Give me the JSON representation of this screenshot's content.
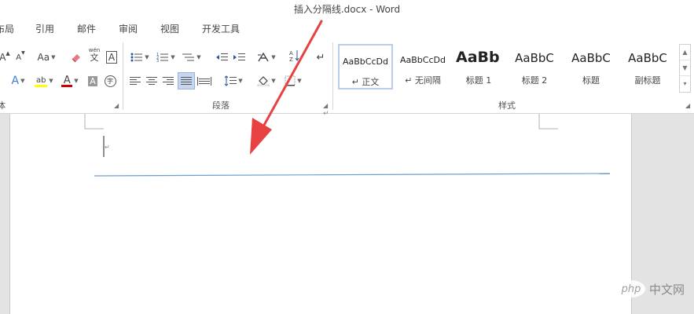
{
  "window": {
    "title": "插入分隔线.docx - Word"
  },
  "tabs": [
    "布局",
    "引用",
    "邮件",
    "审阅",
    "视图",
    "开发工具"
  ],
  "ribbon": {
    "font_size_buttons": {
      "grow": "A",
      "shrink": "A",
      "change_case": "Aa"
    },
    "phonetic_label": "wén",
    "phonetic_char": "文",
    "border_char": "A",
    "char_shading": "A",
    "enclose_char": "字",
    "font_color_letter": "A",
    "text_effect_letter": "A",
    "groups": {
      "font_label": "体",
      "paragraph_label": "段落",
      "styles_label": "样式"
    },
    "styles": [
      {
        "sample": "AaBbCcDd",
        "name": "↵ 正文",
        "selected": true
      },
      {
        "sample": "AaBbCcDd",
        "name": "↵ 无间隔",
        "selected": false
      },
      {
        "sample": "AaBb",
        "name": "标题 1",
        "selected": false
      },
      {
        "sample": "AaBbC",
        "name": "标题 2",
        "selected": false
      },
      {
        "sample": "AaBbC",
        "name": "标题",
        "selected": false
      },
      {
        "sample": "AaBbC",
        "name": "副标题",
        "selected": false
      }
    ]
  },
  "document": {
    "paragraph_mark": "↵",
    "divider_color": "#6a9fcf",
    "arrow_color": "#e84141"
  },
  "watermark": {
    "logo_text": "php",
    "site_text": "中文网"
  },
  "colors": {
    "highlight": "#ffff00",
    "font_color": "#d00000",
    "accent": "#2b579a"
  }
}
